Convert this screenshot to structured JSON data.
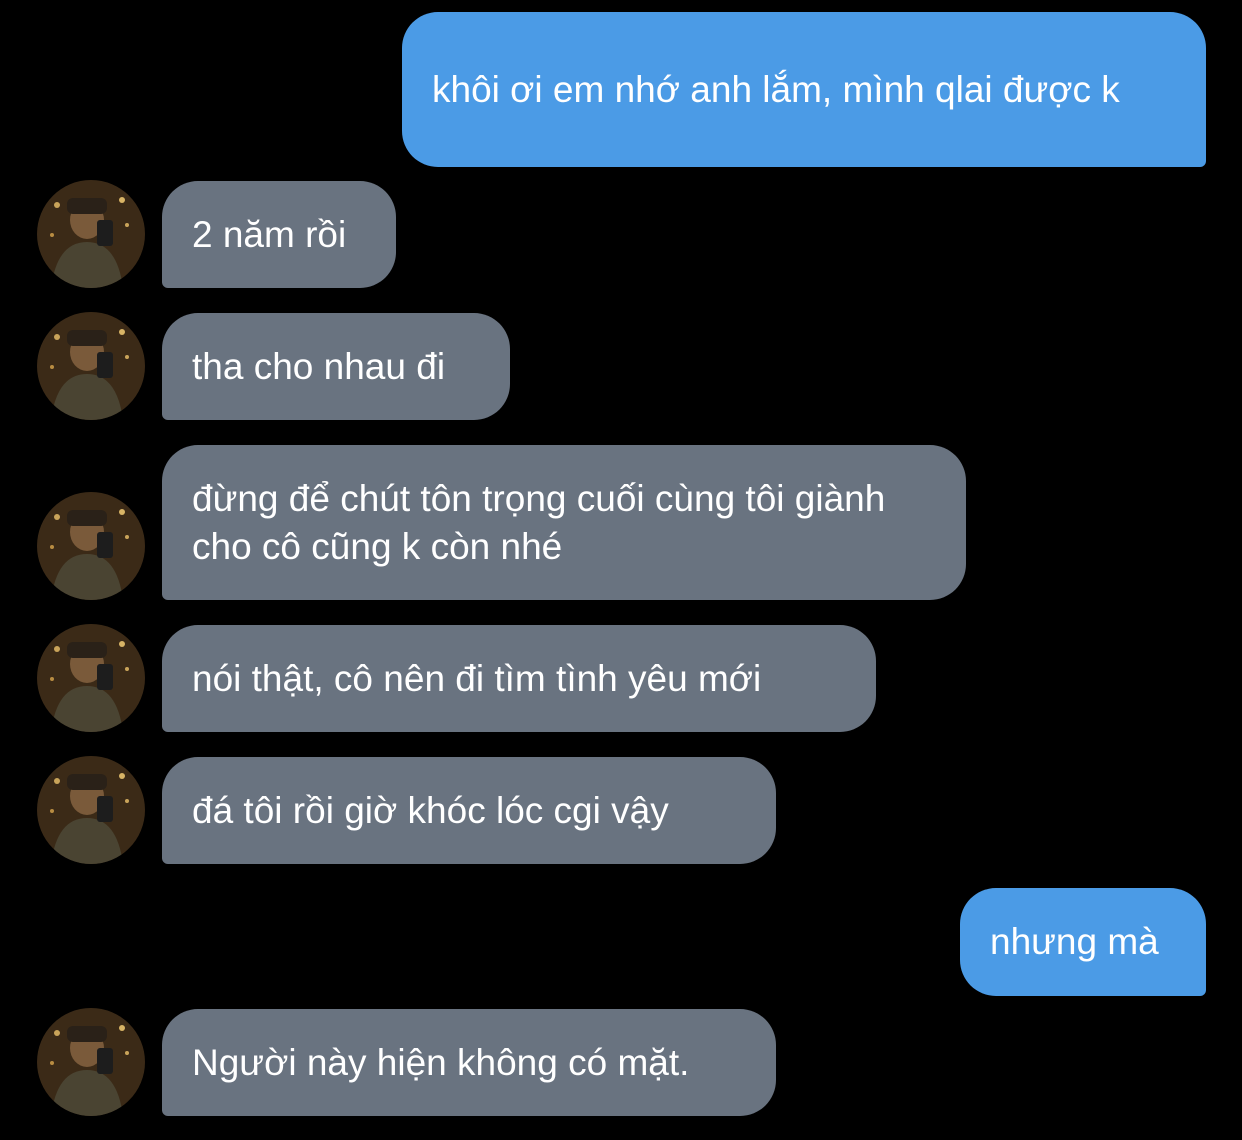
{
  "conversation": {
    "messages": [
      {
        "sender": "me",
        "text": "khôi ơi em nhớ anh lắm, mình qlai được k"
      },
      {
        "sender": "contact",
        "text": "2 năm rồi"
      },
      {
        "sender": "contact",
        "text": "tha cho nhau đi"
      },
      {
        "sender": "contact",
        "text": "đừng để chút tôn trọng cuối cùng tôi giành cho cô cũng k còn nhé"
      },
      {
        "sender": "contact",
        "text": "nói thật, cô nên đi tìm tình yêu mới"
      },
      {
        "sender": "contact",
        "text": "đá tôi rồi giờ khóc lóc cgi vậy"
      },
      {
        "sender": "me",
        "text": "nhưng mà"
      },
      {
        "sender": "contact",
        "text": "Người này hiện không có mặt."
      }
    ]
  },
  "colors": {
    "background": "#000000",
    "sent_bubble": "#4b9be6",
    "received_bubble": "#697380",
    "text": "#ffffff"
  }
}
